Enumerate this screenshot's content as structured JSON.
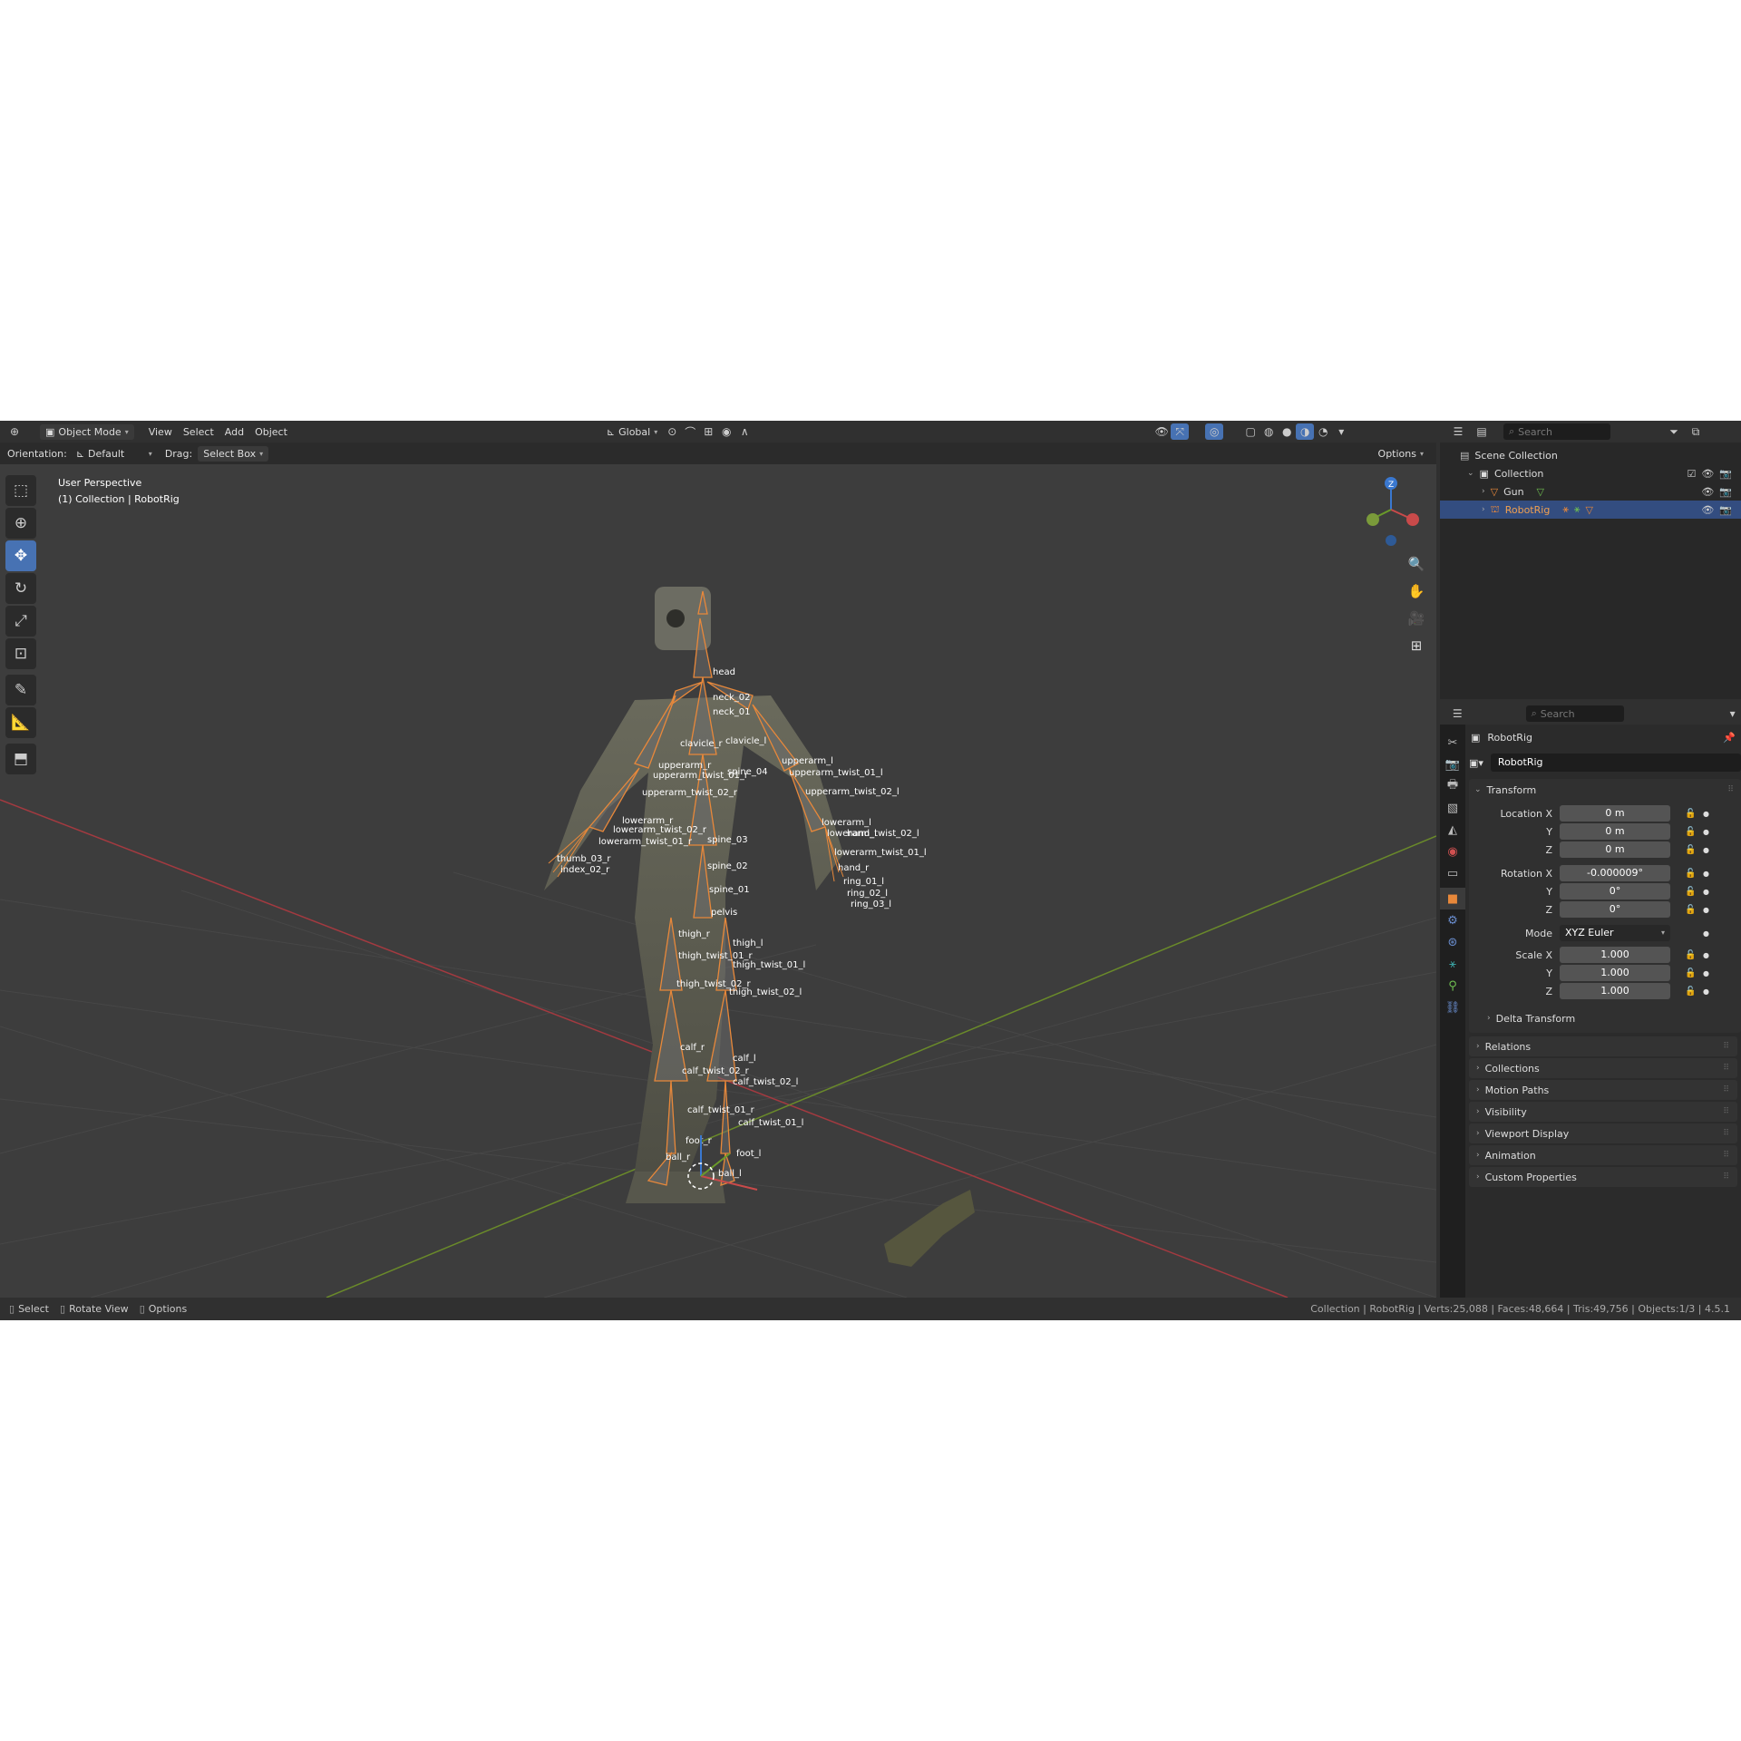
{
  "header": {
    "mode": "Object Mode",
    "menus": [
      "View",
      "Select",
      "Add",
      "Object"
    ],
    "transform_orientation": "Global"
  },
  "tool_settings": {
    "orientation_label": "Orientation:",
    "orientation_value": "Default",
    "drag_label": "Drag:",
    "drag_value": "Select Box",
    "options": "Options"
  },
  "viewport": {
    "perspective": "User Perspective",
    "context": "(1) Collection | RobotRig",
    "gizmo_z": "Z"
  },
  "bones": [
    "head",
    "neck_02",
    "neck_01",
    "clavicle_r",
    "clavicle_l",
    "upperarm_r",
    "upperarm_l",
    "upperarm_twist_01_r",
    "upperarm_twist_01_l",
    "upperarm_twist_02_r",
    "upperarm_twist_02_l",
    "lowerarm_r",
    "lowerarm_l",
    "lowerarm_twist_02_r",
    "lowerarm_twist_02_l",
    "lowerarm_twist_01_r",
    "lowerarm_twist_01_l",
    "spine_03",
    "spine_02",
    "spine_01",
    "pelvis",
    "thigh_r",
    "thigh_l",
    "thigh_twist_01_r",
    "thigh_twist_01_l",
    "thigh_twist_02_r",
    "thigh_twist_02_l",
    "calf_r",
    "calf_l",
    "calf_twist_02_r",
    "calf_twist_02_l",
    "calf_twist_01_r",
    "calf_twist_01_l",
    "foot_r",
    "foot_l",
    "ball_r",
    "ball_l",
    "spine_04",
    "hand_r",
    "hand_l",
    "thumb_03_r",
    "index_02_r",
    "ring_01_l",
    "ring_02_l",
    "ring_03_l"
  ],
  "outliner": {
    "search_placeholder": "Search",
    "scene_collection": "Scene Collection",
    "collection": "Collection",
    "items": [
      {
        "name": "Gun"
      },
      {
        "name": "RobotRig"
      }
    ]
  },
  "properties": {
    "search_placeholder": "Search",
    "object_name": "RobotRig",
    "datablock_name": "RobotRig",
    "transform_title": "Transform",
    "location_label": "Location X",
    "location": {
      "x": "0 m",
      "y": "0 m",
      "z": "0 m"
    },
    "rotation_label": "Rotation X",
    "rotation": {
      "x": "-0.000009°",
      "y": "0°",
      "z": "0°"
    },
    "mode_label": "Mode",
    "mode_value": "XYZ Euler",
    "scale_label": "Scale X",
    "scale": {
      "x": "1.000",
      "y": "1.000",
      "z": "1.000"
    },
    "axis_y": "Y",
    "axis_z": "Z",
    "delta_transform": "Delta Transform",
    "panels": [
      "Relations",
      "Collections",
      "Motion Paths",
      "Visibility",
      "Viewport Display",
      "Animation",
      "Custom Properties"
    ]
  },
  "statusbar": {
    "select": "Select",
    "rotate_view": "Rotate View",
    "options": "Options",
    "info": "Collection | RobotRig | Verts:25,088 | Faces:48,664 | Tris:49,756 | Objects:1/3 | 4.5.1"
  },
  "colors": {
    "accent": "#4772b3",
    "selection_orange": "#e8883a",
    "x_axis": "#c84a4a",
    "y_axis": "#7a9a3a",
    "z_axis": "#3a78d0"
  }
}
